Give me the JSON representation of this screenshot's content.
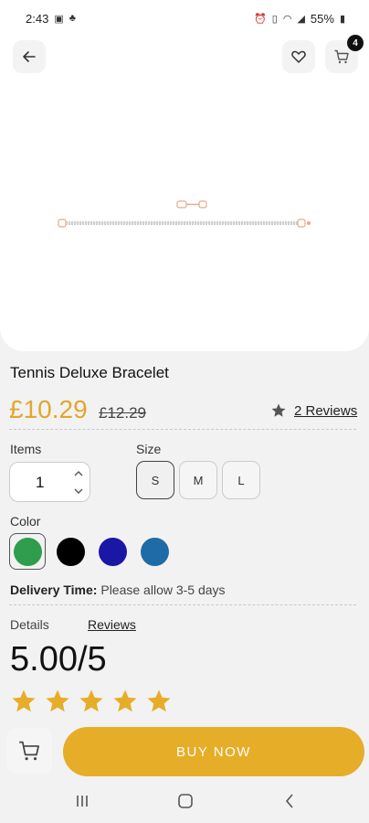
{
  "status_bar": {
    "time": "2:43",
    "battery": "55%"
  },
  "header": {
    "cart_count": "4"
  },
  "product": {
    "title": "Tennis Deluxe Bracelet",
    "price": "£10.29",
    "old_price": "£12.29",
    "reviews_link": "2 Reviews"
  },
  "options": {
    "items_label": "Items",
    "quantity": "1",
    "size_label": "Size",
    "sizes": [
      "S",
      "M",
      "L"
    ],
    "selected_size": "S",
    "color_label": "Color",
    "colors": [
      "#2e9d4e",
      "#000000",
      "#1b17a6",
      "#1e6ba7"
    ],
    "selected_color": "#2e9d4e"
  },
  "delivery": {
    "label": "Delivery Time:",
    "value": "Please allow 3-5 days"
  },
  "tabs": {
    "details": "Details",
    "reviews": "Reviews"
  },
  "rating": {
    "score": "5.00/5",
    "stars": 5,
    "star_color": "#e6ad28"
  },
  "actions": {
    "buy_now": "BUY NOW"
  },
  "icons": [
    "back-arrow-icon",
    "heart-icon",
    "cart-icon",
    "star-icon",
    "chevron-up-icon",
    "chevron-down-icon"
  ]
}
